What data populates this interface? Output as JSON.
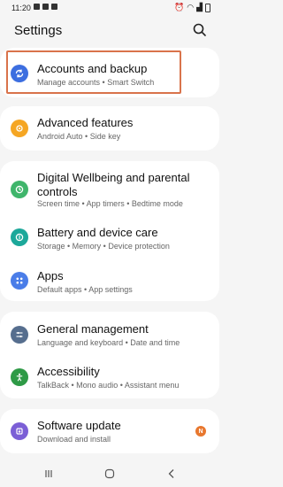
{
  "status_bar": {
    "time": "11:20"
  },
  "header": {
    "title": "Settings"
  },
  "items": [
    {
      "title": "Accounts and backup",
      "sub": "Manage accounts  •  Smart Switch",
      "color": "#3c6ee0"
    },
    {
      "title": "Advanced features",
      "sub": "Android Auto  •  Side key",
      "color": "#f5a623"
    },
    {
      "title": "Digital Wellbeing and parental controls",
      "sub": "Screen time  •  App timers  •  Bedtime mode",
      "color": "#3fb56b"
    },
    {
      "title": "Battery and device care",
      "sub": "Storage  •  Memory  •  Device protection",
      "color": "#1ca89a"
    },
    {
      "title": "Apps",
      "sub": "Default apps  •  App settings",
      "color": "#4a7de8"
    },
    {
      "title": "General management",
      "sub": "Language and keyboard  •  Date and time",
      "color": "#566e8e"
    },
    {
      "title": "Accessibility",
      "sub": "TalkBack  •  Mono audio  •  Assistant menu",
      "color": "#2e9a46"
    },
    {
      "title": "Software update",
      "sub": "Download and install",
      "color": "#7b5fd6",
      "badge": "N"
    }
  ]
}
